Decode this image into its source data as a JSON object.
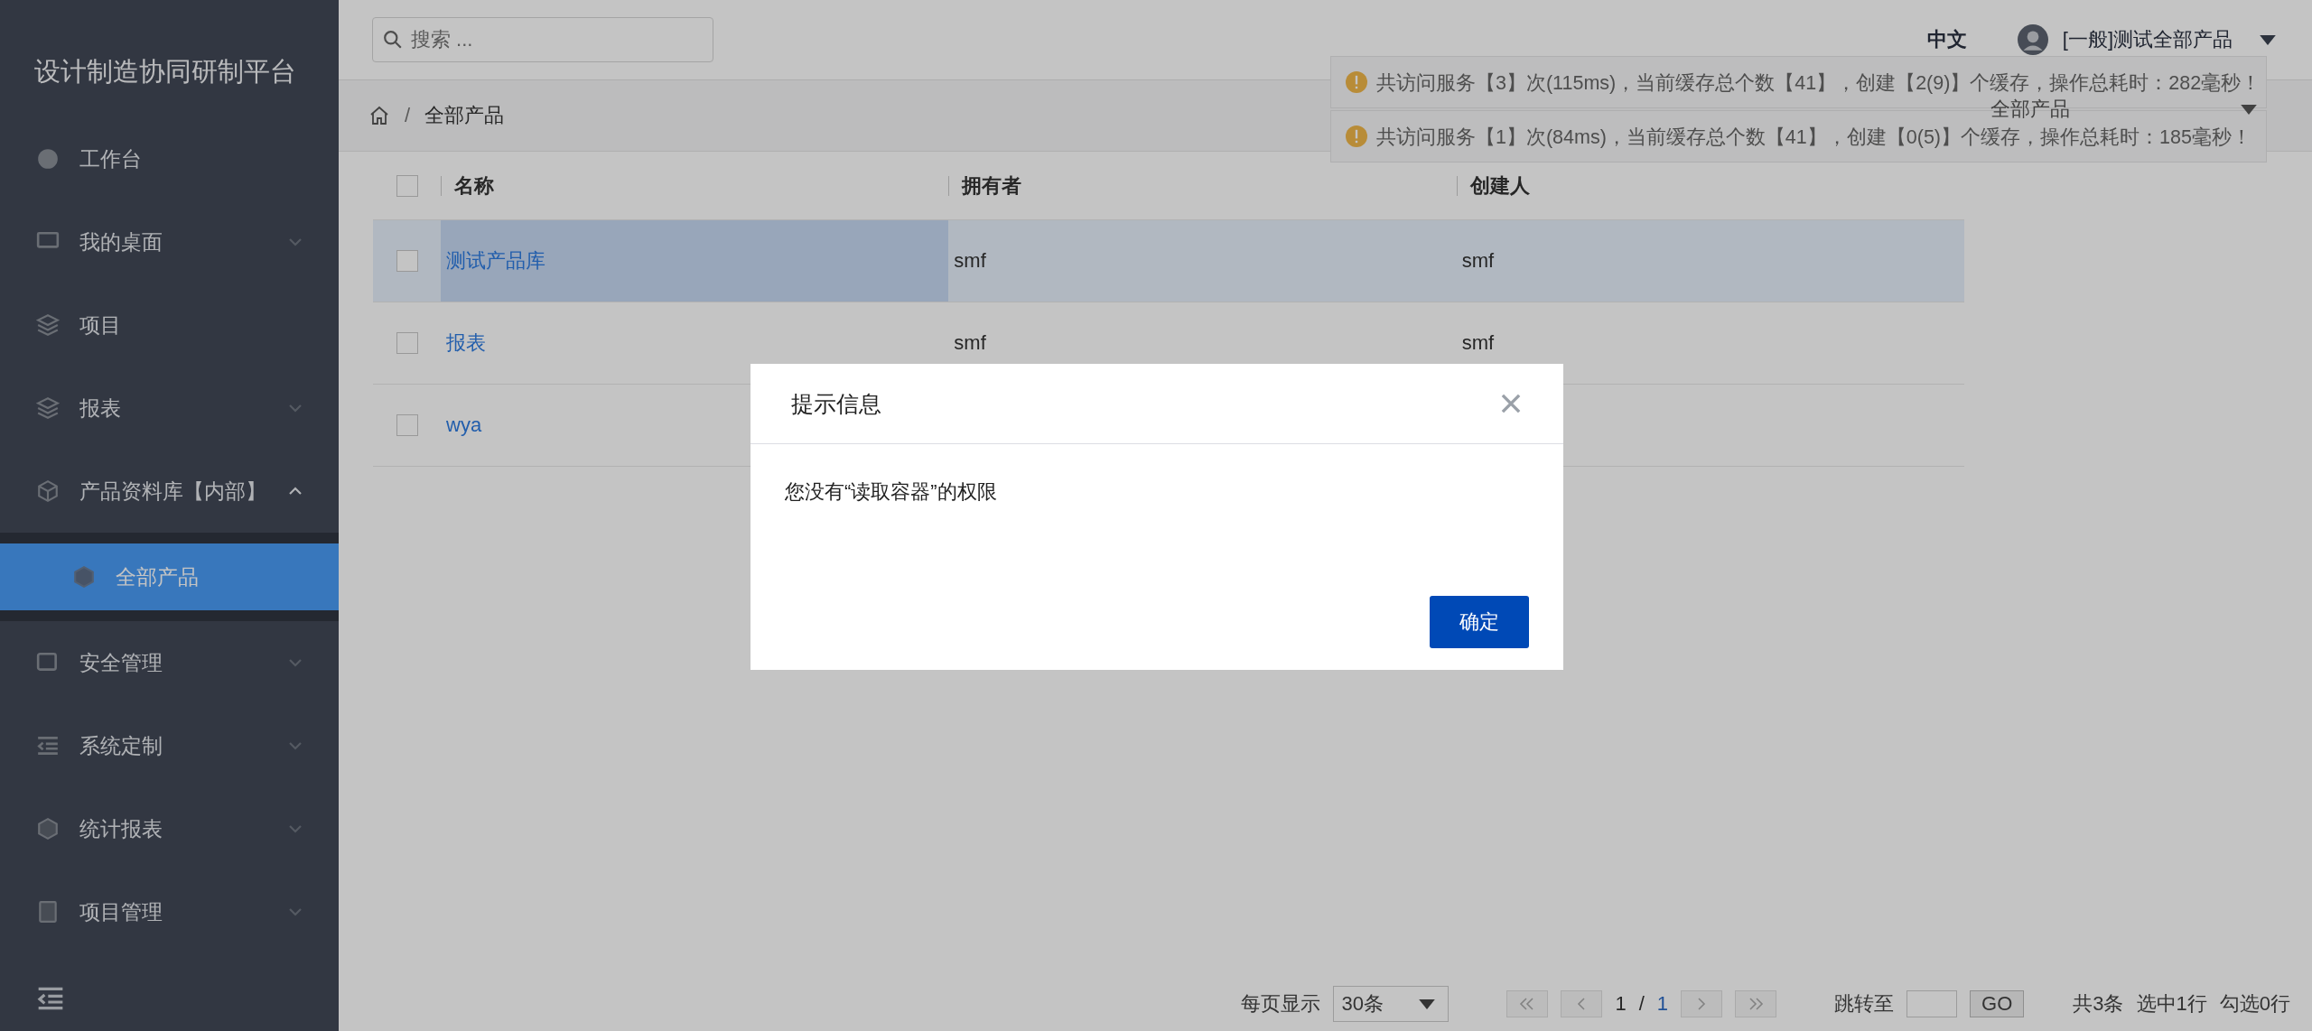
{
  "sidebar": {
    "title": "设计制造协同研制平台",
    "items": [
      {
        "label": "工作台",
        "kind": "link"
      },
      {
        "label": "我的桌面",
        "kind": "group",
        "expanded": false
      },
      {
        "label": "项目",
        "kind": "link"
      },
      {
        "label": "报表",
        "kind": "group",
        "expanded": false
      },
      {
        "label": "产品资料库【内部】",
        "kind": "group",
        "expanded": true,
        "children": [
          {
            "label": "全部产品",
            "selected": true
          }
        ]
      },
      {
        "label": "安全管理",
        "kind": "group",
        "expanded": false
      },
      {
        "label": "系统定制",
        "kind": "group",
        "expanded": false
      },
      {
        "label": "统计报表",
        "kind": "group",
        "expanded": false
      },
      {
        "label": "项目管理",
        "kind": "group",
        "expanded": false
      }
    ]
  },
  "topbar": {
    "search": {
      "placeholder": "搜索 ..."
    },
    "language": {
      "label": "中文",
      "selected": true
    },
    "user": "[一般]测试全部产品"
  },
  "notifications": [
    {
      "text": "共访问服务【3】次(115ms)，当前缓存总个数【41】，创建【2(9)】个缓存，操作总耗时：282毫秒！"
    },
    {
      "text": "共访问服务【1】次(84ms)，当前缓存总个数【41】，创建【0(5)】个缓存，操作总耗时：185毫秒！"
    }
  ],
  "breadcrumb": {
    "separator": "/",
    "items": [
      "全部产品"
    ]
  },
  "view_select": "全部产品",
  "table": {
    "all_checked": false,
    "columns": [
      "名称",
      "拥有者",
      "创建人"
    ],
    "rows": [
      {
        "name": "测试产品库",
        "owner": "smf",
        "creator": "smf",
        "selected": true,
        "checked": false
      },
      {
        "name": "报表",
        "owner": "smf",
        "creator": "smf",
        "selected": false,
        "checked": false
      },
      {
        "name": "wya",
        "selected": false,
        "checked": false
      }
    ]
  },
  "pagination": {
    "page_size_label": "每页显示",
    "page_size": "30条",
    "current": "1",
    "separator": "/",
    "total_pages": "1",
    "jump_label": "跳转至",
    "go": "GO",
    "total": "共3条",
    "selected_count": "选中1行",
    "checked_count": "勾选0行"
  },
  "dialog": {
    "title": "提示信息",
    "message": "您没有“读取容器”的权限",
    "confirm": "确定"
  }
}
